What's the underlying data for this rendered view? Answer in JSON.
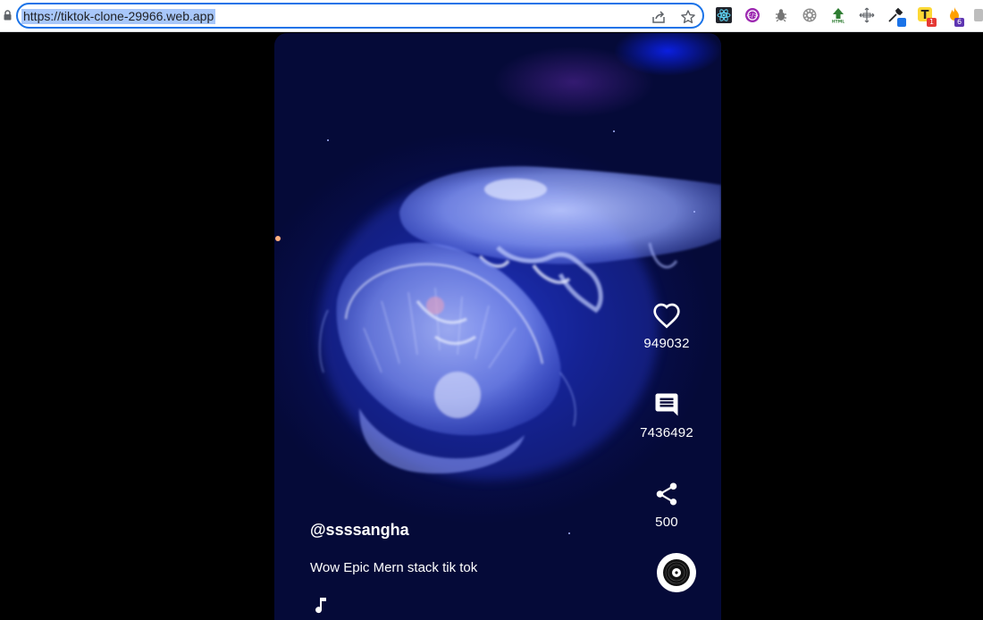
{
  "browser": {
    "url": "https://tiktok-clone-29966.web.app",
    "extensions": [
      {
        "name": "react-devtools-icon"
      },
      {
        "name": "extension-purple-icon"
      },
      {
        "name": "bug-icon"
      },
      {
        "name": "gear-extension-icon"
      },
      {
        "name": "html-extension-icon"
      },
      {
        "name": "move-icon"
      },
      {
        "name": "eyedropper-icon"
      },
      {
        "name": "t-extension-icon",
        "badge": "1"
      },
      {
        "name": "fire-extension-icon",
        "badge": "6"
      },
      {
        "name": "puzzle-icon"
      }
    ]
  },
  "video": {
    "username": "@ssssangha",
    "description": "Wow Epic Mern stack tik tok",
    "actions": {
      "likes": "949032",
      "comments": "7436492",
      "shares": "500"
    }
  }
}
